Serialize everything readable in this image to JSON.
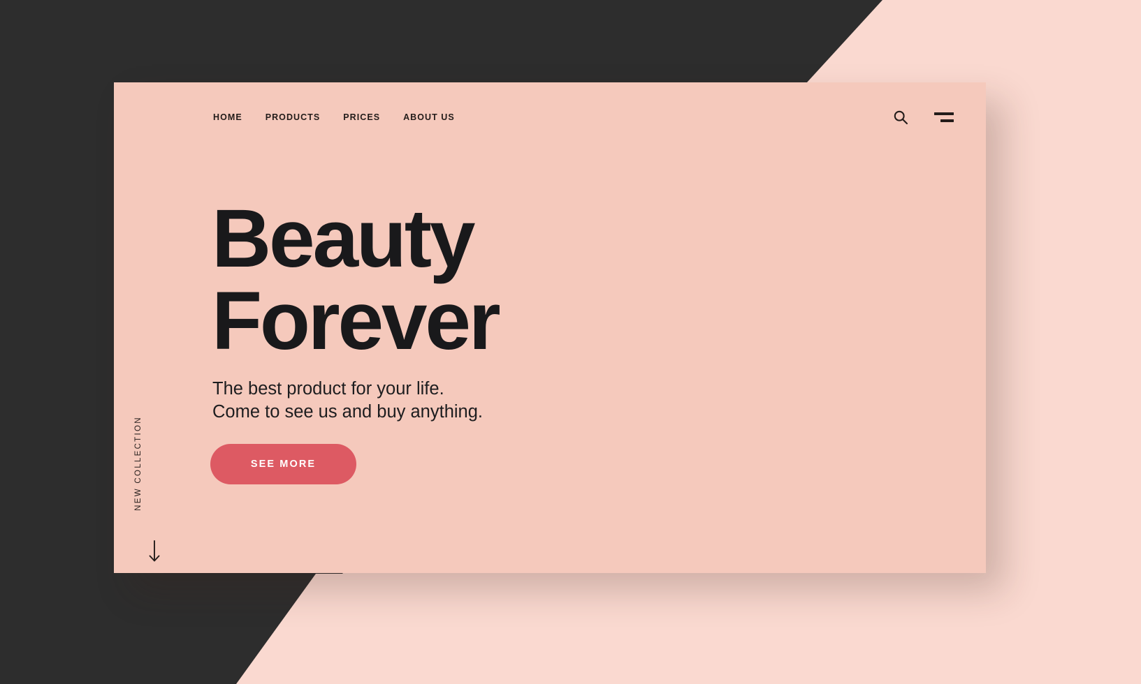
{
  "theme": {
    "card_bg": "#F5C9BC",
    "page_bg": "#FAD9D0",
    "dark_bg": "#2D2D2D",
    "accent": "#DD5A63",
    "text_dark": "#19191b",
    "text_on_accent": "#FFFFFF"
  },
  "nav": {
    "items": [
      {
        "label": "HOME"
      },
      {
        "label": "PRODUCTS"
      },
      {
        "label": "PRICES"
      },
      {
        "label": "ABOUT US"
      }
    ]
  },
  "icons": {
    "search": "search-icon",
    "menu": "hamburger-menu-icon",
    "scroll": "arrow-down-icon"
  },
  "hero": {
    "headline": "Beauty\nForever",
    "subtitle": "The best product for your life.\nCome to see us and buy anything.",
    "cta_label": "SEE MORE",
    "vertical_label": "NEW COLLECTION"
  }
}
